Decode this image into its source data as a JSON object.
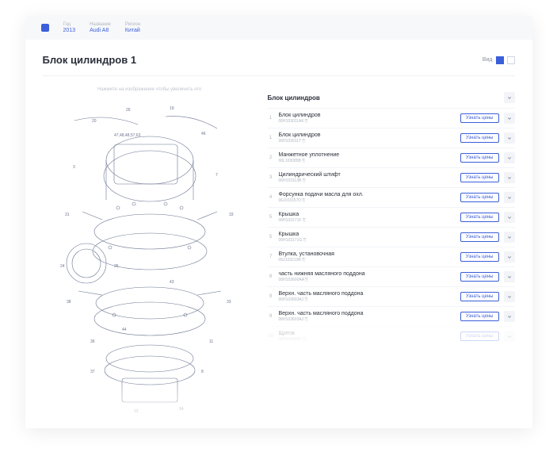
{
  "header": {
    "cols": [
      {
        "label": "Год",
        "value": "2013"
      },
      {
        "label": "Название",
        "value": "Audi A8"
      },
      {
        "label": "Регион",
        "value": "Китай"
      }
    ]
  },
  "title": "Блок цилиндров 1",
  "view_label": "Вид",
  "diagram_hint": "Нажмите на изображение чтобы увеличить его",
  "section_title": "Блок цилиндров",
  "price_btn": "Узнать цены",
  "parts": [
    {
      "num": "1",
      "name": "Блок цилиндров",
      "code": "06H103011АК"
    },
    {
      "num": "1",
      "name": "Блок цилиндров",
      "code": "06H103011Т"
    },
    {
      "num": "2",
      "name": "Манжетное уплотнение",
      "code": "06L103085B"
    },
    {
      "num": "3",
      "name": "Цилиндрический штифт",
      "code": "06H103113B"
    },
    {
      "num": "4",
      "name": "Форсунка подачи масла для охл.",
      "code": "06J103157D"
    },
    {
      "num": "5",
      "name": "Крышка",
      "code": "06H103171F"
    },
    {
      "num": "5",
      "name": "Крышка",
      "code": "06H103171G"
    },
    {
      "num": "7",
      "name": "Втулка, установочная",
      "code": "052103219B"
    },
    {
      "num": "8",
      "name": "часть нижняя масляного поддона",
      "code": "06H103600AA"
    },
    {
      "num": "9",
      "name": "Верхн. часть масляного поддона",
      "code": "06H103603AJ"
    },
    {
      "num": "9",
      "name": "Верхн. часть масляного поддона",
      "code": "06H103603AJ"
    },
    {
      "num": "10",
      "name": "Щиток",
      "code": "06H103660C",
      "faded": true
    }
  ]
}
